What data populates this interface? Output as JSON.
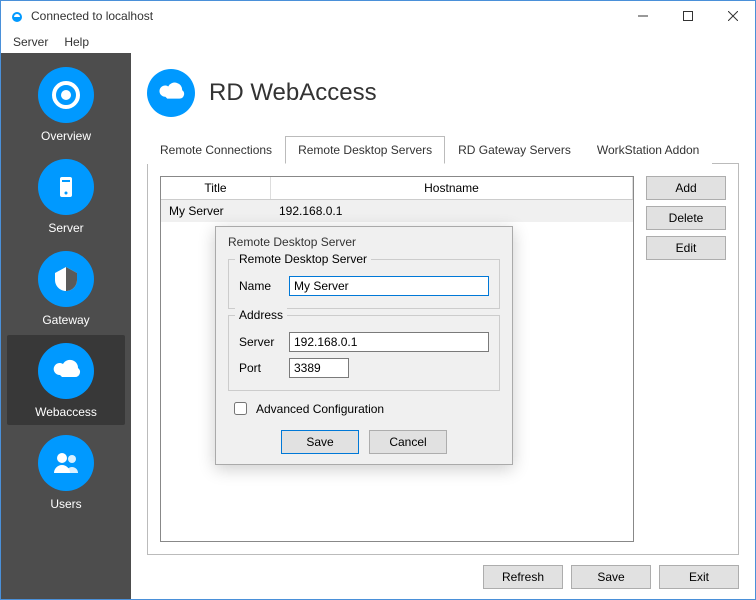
{
  "window": {
    "title": "Connected to localhost"
  },
  "menu": {
    "server": "Server",
    "help": "Help"
  },
  "sidebar": {
    "items": [
      {
        "label": "Overview"
      },
      {
        "label": "Server"
      },
      {
        "label": "Gateway"
      },
      {
        "label": "Webaccess"
      },
      {
        "label": "Users"
      }
    ]
  },
  "page": {
    "title": "RD WebAccess"
  },
  "tabs": {
    "t0": "Remote Connections",
    "t1": "Remote Desktop Servers",
    "t2": "RD Gateway Servers",
    "t3": "WorkStation Addon"
  },
  "table": {
    "col_title": "Title",
    "col_host": "Hostname",
    "rows": [
      {
        "title": "My Server",
        "host": "192.168.0.1"
      }
    ]
  },
  "buttons": {
    "add": "Add",
    "delete": "Delete",
    "edit": "Edit",
    "refresh": "Refresh",
    "save": "Save",
    "exit": "Exit",
    "cancel": "Cancel"
  },
  "dialog": {
    "title": "Remote Desktop Server",
    "group1": "Remote Desktop Server",
    "name_label": "Name",
    "name_value": "My Server",
    "group2": "Address",
    "server_label": "Server",
    "server_value": "192.168.0.1",
    "port_label": "Port",
    "port_value": "3389",
    "adv_label": "Advanced Configuration",
    "save": "Save",
    "cancel": "Cancel"
  }
}
